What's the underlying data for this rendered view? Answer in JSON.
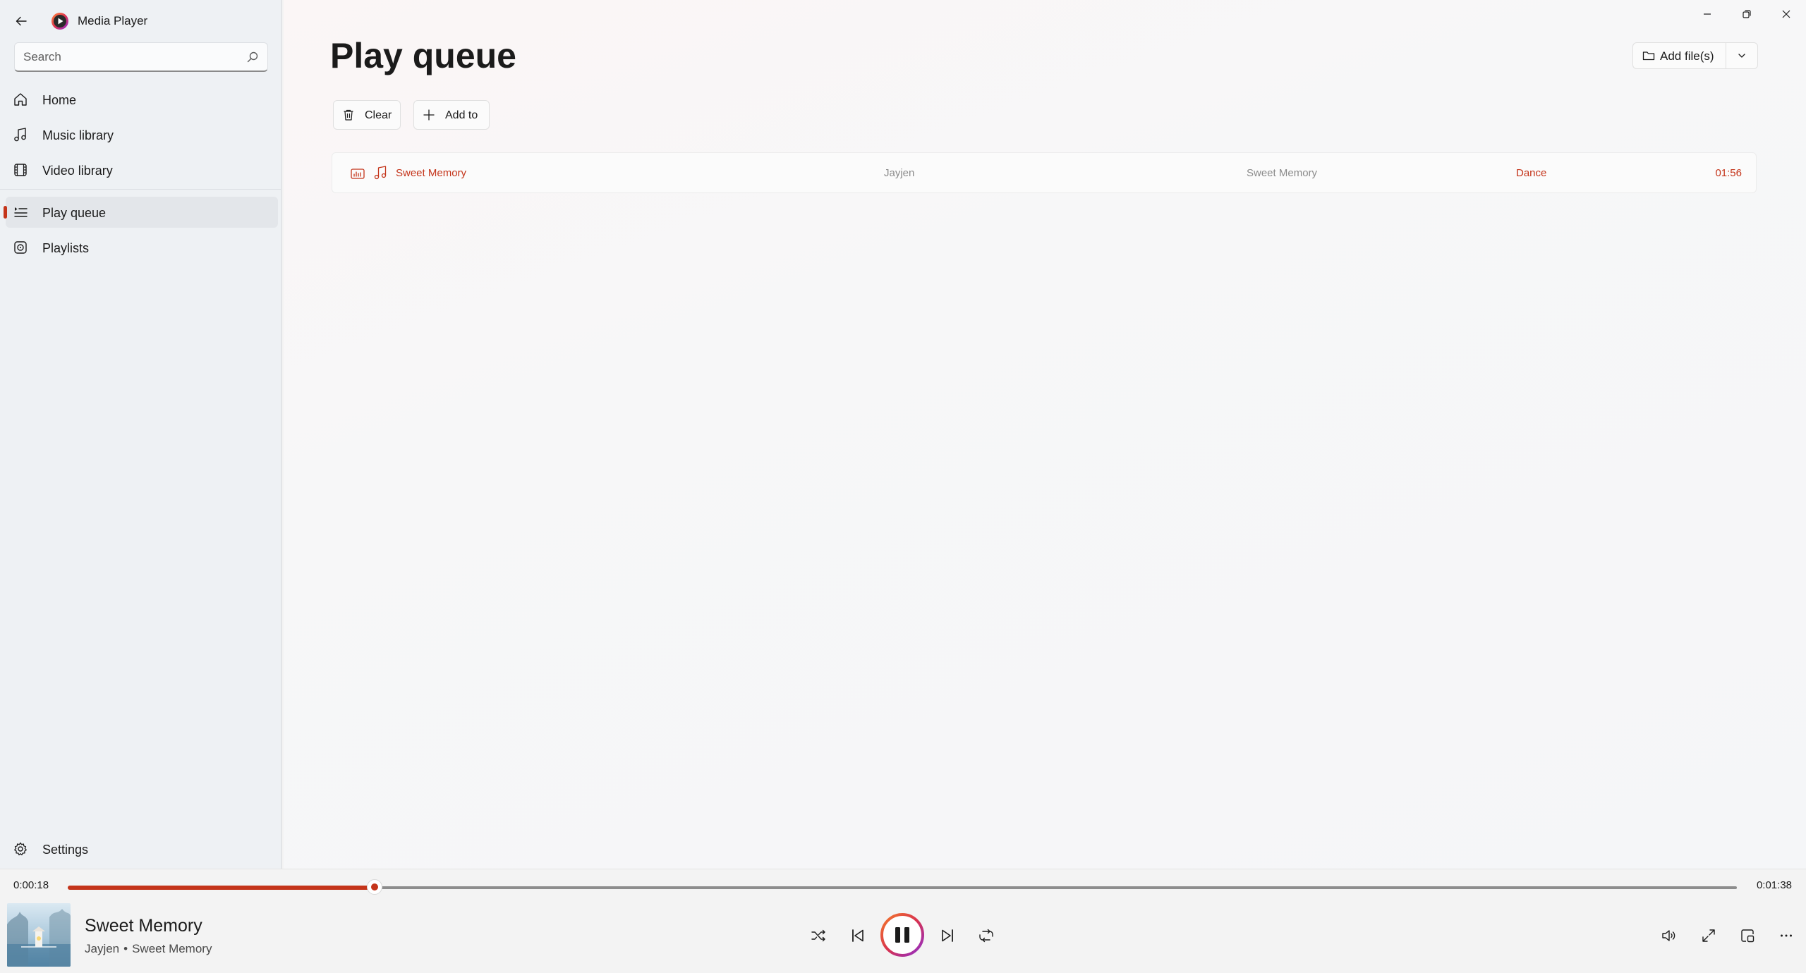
{
  "app": {
    "title": "Media Player"
  },
  "search": {
    "placeholder": "Search",
    "value": ""
  },
  "nav": {
    "items": [
      {
        "label": "Home",
        "icon": "home-icon"
      },
      {
        "label": "Music library",
        "icon": "music-note-icon"
      },
      {
        "label": "Video library",
        "icon": "film-icon"
      },
      {
        "label": "Play queue",
        "icon": "queue-icon",
        "selected": true
      },
      {
        "label": "Playlists",
        "icon": "playlist-icon"
      }
    ],
    "settings_label": "Settings"
  },
  "page": {
    "title": "Play queue",
    "add_files_label": "Add file(s)",
    "clear_label": "Clear",
    "add_to_label": "Add to"
  },
  "queue": [
    {
      "title": "Sweet Memory",
      "artist": "Jayjen",
      "album": "Sweet Memory",
      "genre": "Dance",
      "duration": "01:56",
      "now_playing": true
    }
  ],
  "player": {
    "elapsed": "0:00:18",
    "total": "0:01:38",
    "progress_fraction": 0.1837,
    "track_title": "Sweet Memory",
    "artist": "Jayjen",
    "separator": "•",
    "album": "Sweet Memory",
    "state": "playing"
  },
  "colors": {
    "accent": "#c4341a",
    "sidebar_bg": "#eef1f4",
    "text": "#1b1b1b",
    "muted_text": "#8a8a8a"
  }
}
